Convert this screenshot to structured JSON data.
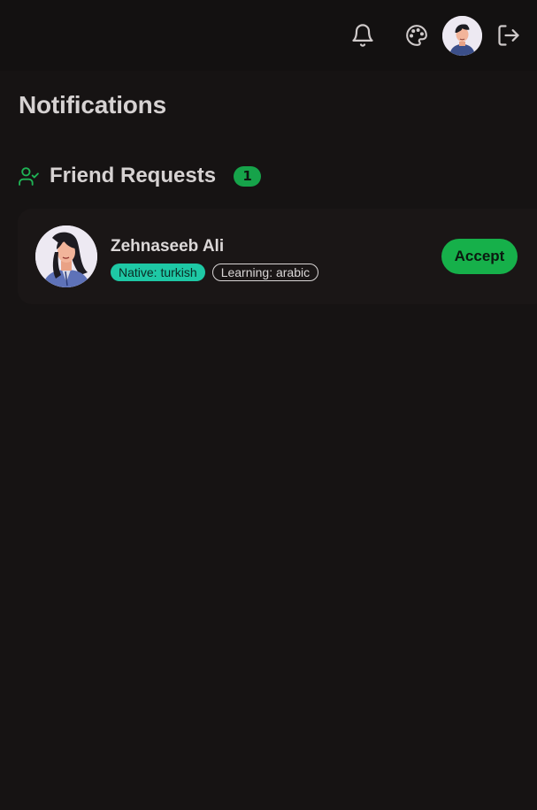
{
  "header": {
    "icons": {
      "notifications": "bell-icon",
      "theme": "palette-icon",
      "logout": "logout-icon"
    },
    "avatar_alt": "user-avatar"
  },
  "page": {
    "title": "Notifications"
  },
  "friend_requests": {
    "icon": "user-check-icon",
    "title": "Friend Requests",
    "count": "1",
    "items": [
      {
        "name": "Zehnaseeb Ali",
        "native": "Native: turkish",
        "learning": "Learning: arabic",
        "accept_label": "Accept"
      }
    ]
  },
  "colors": {
    "background": "#161313",
    "topbar": "#131111",
    "card": "#1a1616",
    "accent_green": "#16a34a",
    "native_badge": "#1ec8a5"
  }
}
